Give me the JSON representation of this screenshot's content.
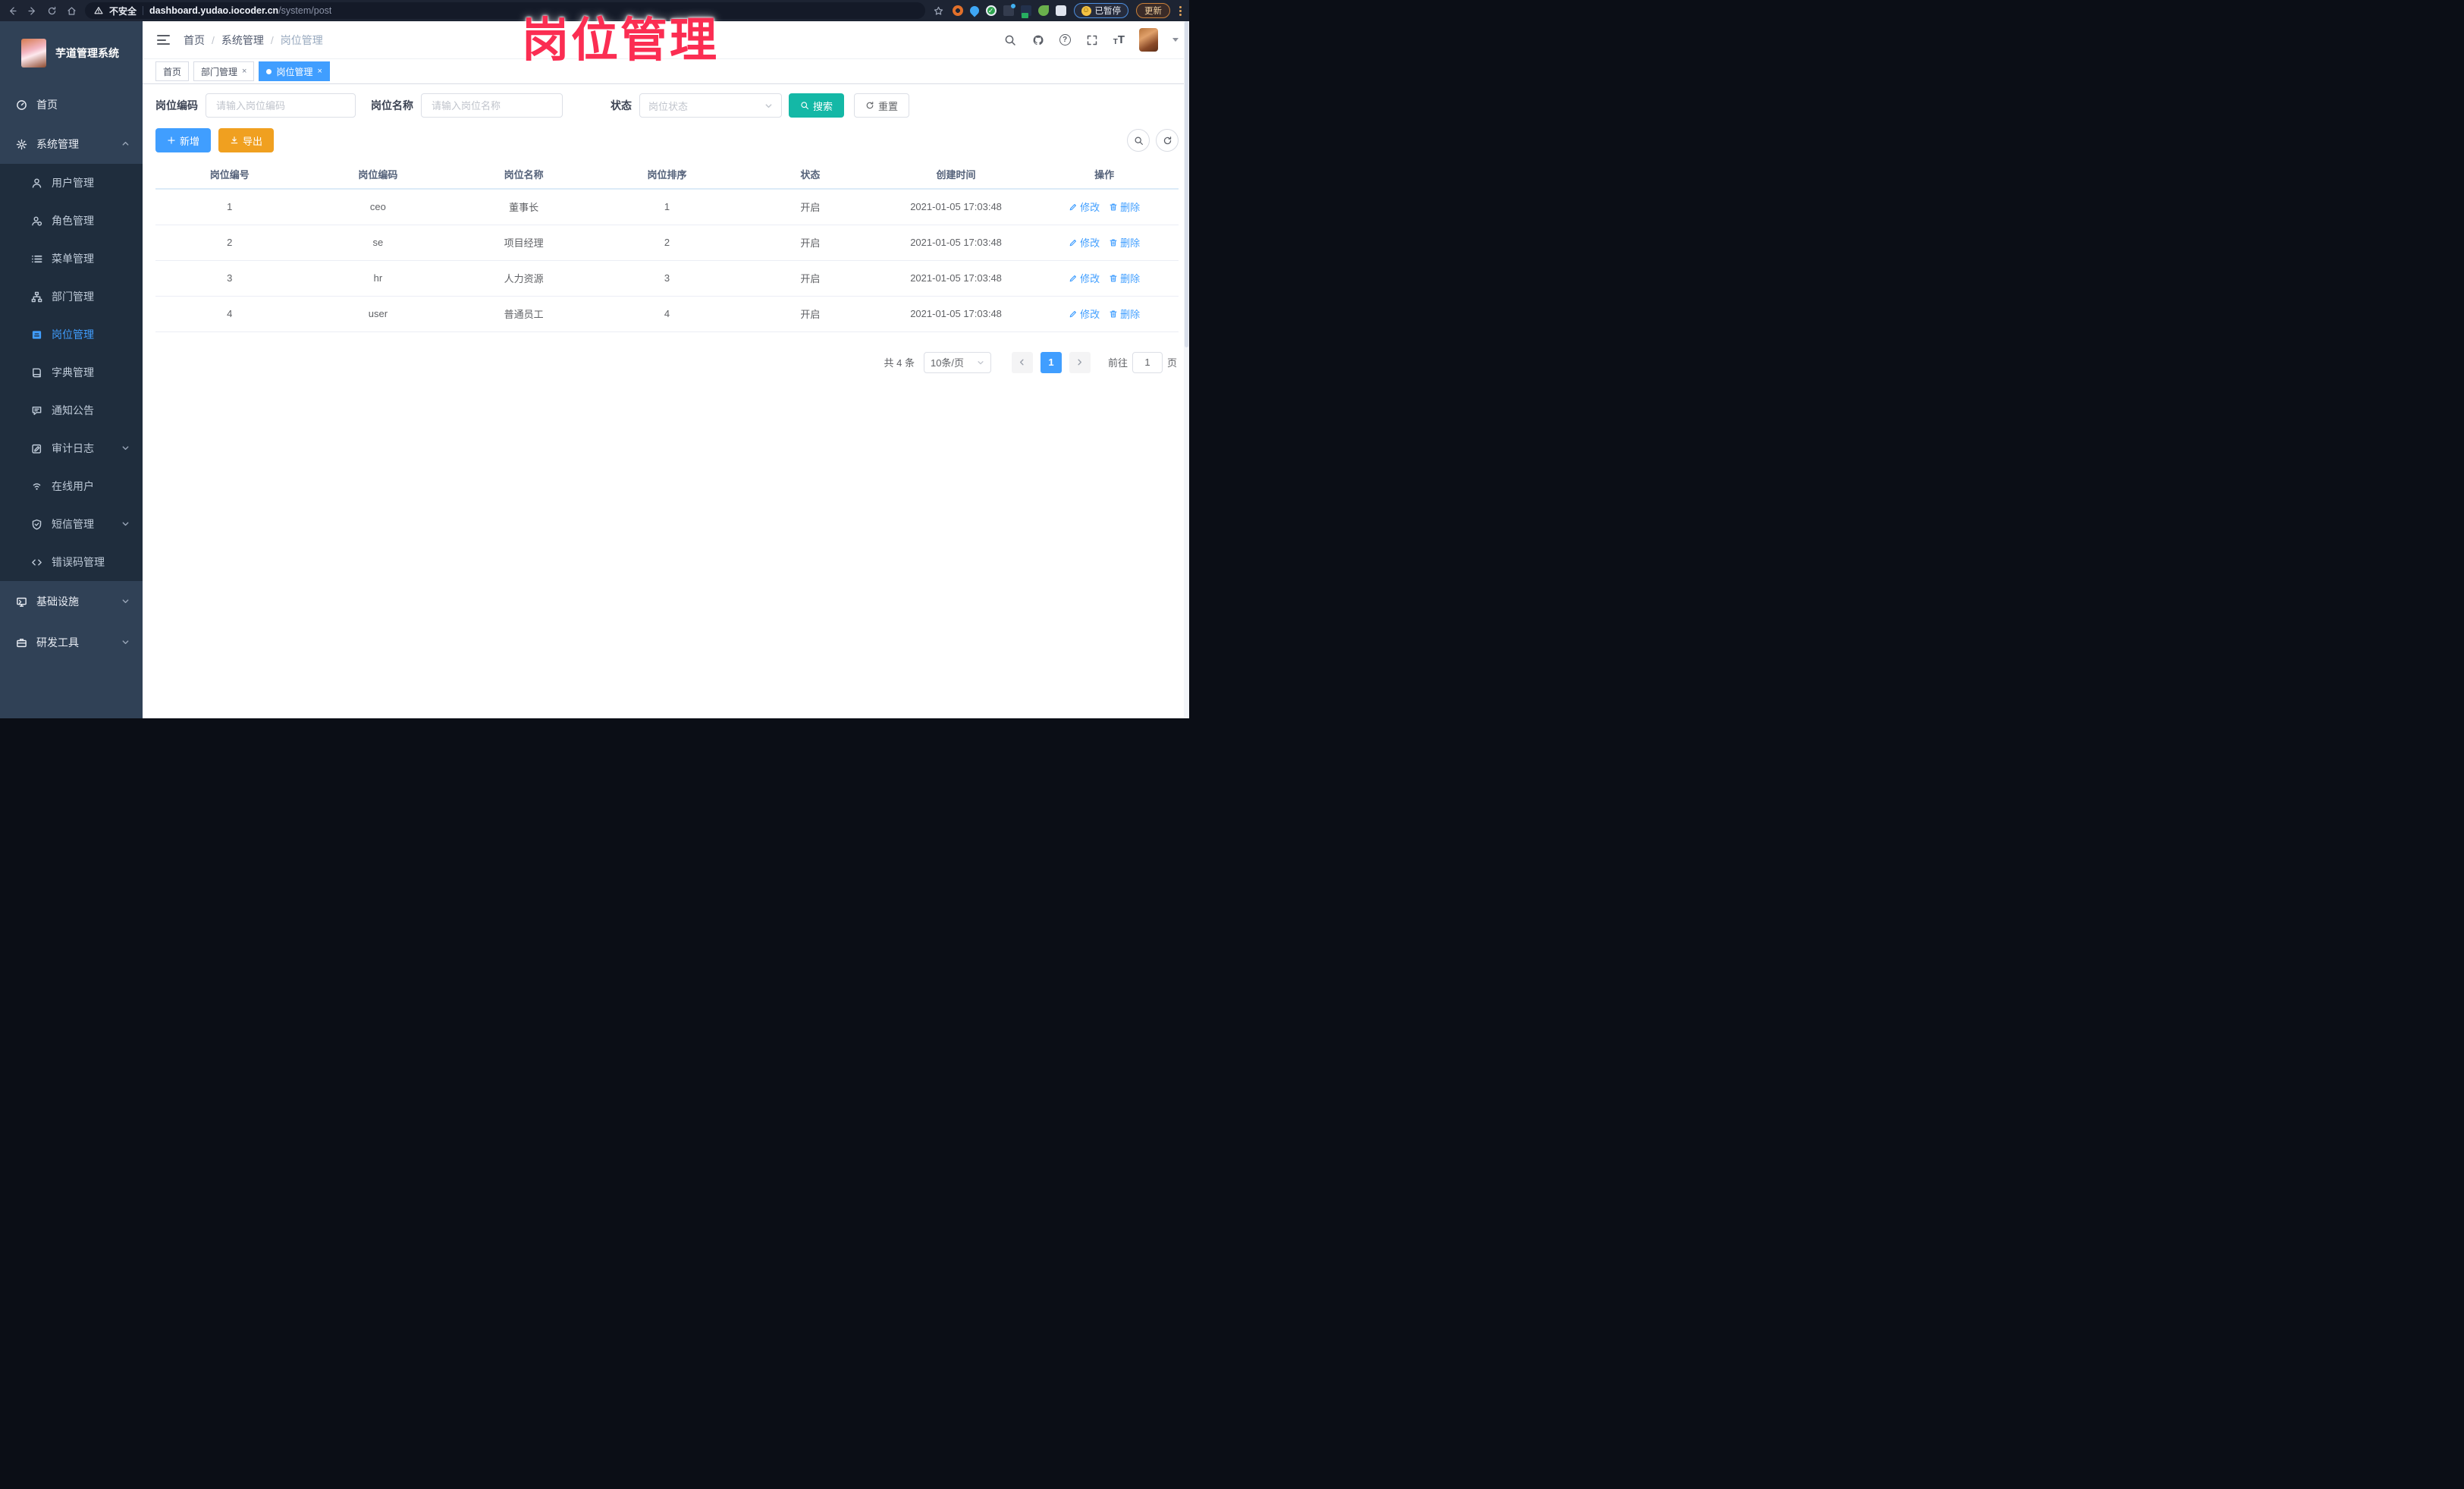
{
  "browser": {
    "security_label": "不安全",
    "url_host": "dashboard.yudao.iocoder.cn",
    "url_path": "/system/post",
    "paused_badge": "已暂停",
    "update_button": "更新"
  },
  "overlay": {
    "title": "岗位管理"
  },
  "sidebar": {
    "app_title": "芋道管理系统",
    "items": [
      {
        "label": "首页"
      },
      {
        "label": "系统管理"
      },
      {
        "label": "用户管理"
      },
      {
        "label": "角色管理"
      },
      {
        "label": "菜单管理"
      },
      {
        "label": "部门管理"
      },
      {
        "label": "岗位管理"
      },
      {
        "label": "字典管理"
      },
      {
        "label": "通知公告"
      },
      {
        "label": "审计日志"
      },
      {
        "label": "在线用户"
      },
      {
        "label": "短信管理"
      },
      {
        "label": "错误码管理"
      },
      {
        "label": "基础设施"
      },
      {
        "label": "研发工具"
      }
    ]
  },
  "header": {
    "breadcrumb": [
      {
        "label": "首页"
      },
      {
        "label": "系统管理"
      },
      {
        "label": "岗位管理"
      }
    ]
  },
  "tabs": [
    {
      "label": "首页"
    },
    {
      "label": "部门管理"
    },
    {
      "label": "岗位管理"
    }
  ],
  "filters": {
    "code_label": "岗位编码",
    "code_placeholder": "请输入岗位编码",
    "name_label": "岗位名称",
    "name_placeholder": "请输入岗位名称",
    "status_label": "状态",
    "status_placeholder": "岗位状态",
    "search_label": "搜索",
    "reset_label": "重置"
  },
  "toolbar": {
    "add_label": "新增",
    "export_label": "导出"
  },
  "table": {
    "headers": [
      "岗位编号",
      "岗位编码",
      "岗位名称",
      "岗位排序",
      "状态",
      "创建时间",
      "操作"
    ],
    "edit_label": "修改",
    "delete_label": "删除",
    "rows": [
      {
        "id": "1",
        "code": "ceo",
        "name": "董事长",
        "sort": "1",
        "status": "开启",
        "created": "2021-01-05 17:03:48"
      },
      {
        "id": "2",
        "code": "se",
        "name": "项目经理",
        "sort": "2",
        "status": "开启",
        "created": "2021-01-05 17:03:48"
      },
      {
        "id": "3",
        "code": "hr",
        "name": "人力资源",
        "sort": "3",
        "status": "开启",
        "created": "2021-01-05 17:03:48"
      },
      {
        "id": "4",
        "code": "user",
        "name": "普通员工",
        "sort": "4",
        "status": "开启",
        "created": "2021-01-05 17:03:48"
      }
    ]
  },
  "pagination": {
    "total_text": "共 4 条",
    "page_size": "10条/页",
    "current_page": "1",
    "goto_label": "前往",
    "goto_value": "1",
    "page_suffix": "页"
  },
  "colors": {
    "accent_blue": "#409EFF",
    "search_teal": "#14b8a6",
    "export_orange": "#F0A020",
    "overlay_pink": "#fb2d52",
    "sidebar_bg": "#304156",
    "submenu_bg": "#1f2d3d"
  }
}
